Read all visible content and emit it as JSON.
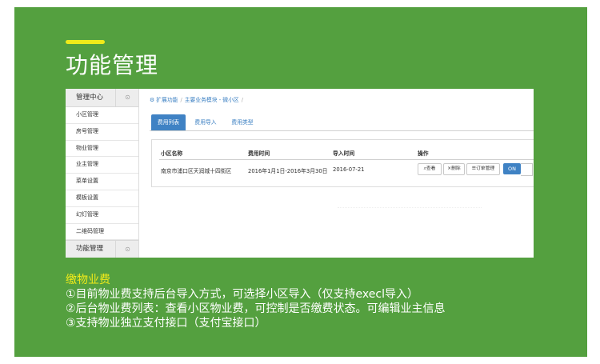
{
  "title": "功能管理",
  "screenshot": {
    "sidebar": {
      "header": "管理中心",
      "items": [
        "小区管理",
        "房号管理",
        "物业管理",
        "业主管理",
        "菜单设置",
        "模板设置",
        "幻灯管理",
        "二维码管理"
      ],
      "footer": "功能管理"
    },
    "breadcrumb": [
      "扩展功能",
      "主要业务模块 - 微小区"
    ],
    "tabs": [
      "费用列表",
      "费用导入",
      "费用类型"
    ],
    "table": {
      "headers": [
        "小区名称",
        "费用时间",
        "导入时间",
        "操作"
      ],
      "row": {
        "name": "南京市浦口区天润城十四街区",
        "period": "2016年1月1日-2016年3月30日",
        "import_time": "2016-07-21",
        "btn_view": "查看",
        "btn_delete": "删除",
        "btn_orders": "订单管理",
        "toggle": "ON"
      }
    }
  },
  "section": {
    "subtitle": "缴物业费",
    "lines": [
      "①目前物业费支持后台导入方式，可选择小区导入（仅支持execl导入）",
      "②后台物业费列表：查看小区物业费，可控制是否缴费状态。可编辑业主信息",
      "③支持物业独立支付接口（支付宝接口）"
    ]
  },
  "colors": {
    "panel": "#54a03f",
    "accent": "#f0ea1a",
    "primary": "#3f82c4"
  }
}
